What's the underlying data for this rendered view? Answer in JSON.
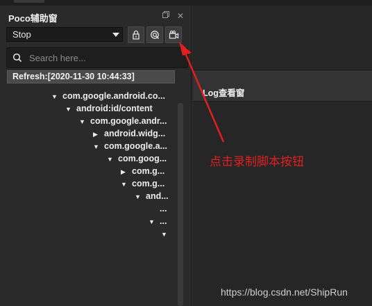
{
  "panel": {
    "title": "Poco辅助窗",
    "mode_select": {
      "value": "Stop"
    },
    "search": {
      "placeholder": "Search here..."
    },
    "refresh_label": "Refresh:[2020-11-30 10:44:33]",
    "tree": [
      {
        "label": "com.google.android.co...",
        "expanded": true
      },
      {
        "label": "android:id/content",
        "expanded": true
      },
      {
        "label": "com.google.andr...",
        "expanded": true
      },
      {
        "label": "android.widg...",
        "expanded": false
      },
      {
        "label": "com.google.a...",
        "expanded": true
      },
      {
        "label": "com.goog...",
        "expanded": true
      },
      {
        "label": "com.g...",
        "expanded": false
      },
      {
        "label": "com.g...",
        "expanded": true
      },
      {
        "label": "and...",
        "expanded": true
      },
      {
        "label": "...",
        "expanded": null
      },
      {
        "label": "...",
        "expanded": true
      },
      {
        "label": "",
        "expanded": true
      }
    ]
  },
  "log_panel": {
    "title": "Log查看窗"
  },
  "annotation": {
    "text": "点击录制脚本按钮",
    "color": "#e02020"
  },
  "watermark": "https://blog.csdn.net/ShipRun",
  "icons": {
    "float": "float-window-icon",
    "close": "close-icon",
    "lock": "lock-icon",
    "inspect": "inspect-icon",
    "record": "record-script-icon",
    "search": "search-icon"
  }
}
